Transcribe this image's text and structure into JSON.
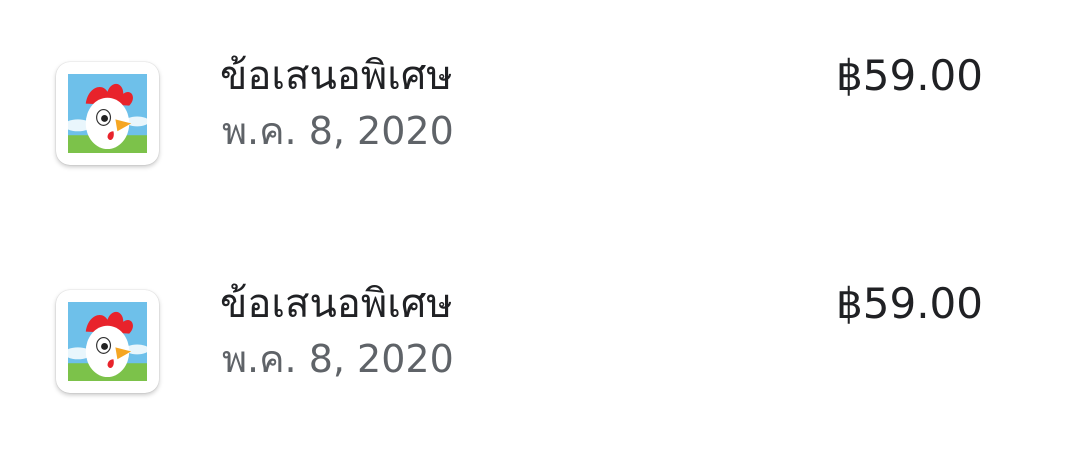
{
  "purchases": [
    {
      "icon": "hay-day-pop-rooster-icon",
      "title": "ข้อเสนอพิเศษ",
      "date": "พ.ค. 8, 2020",
      "price": "฿59.00"
    },
    {
      "icon": "hay-day-pop-rooster-icon",
      "title": "ข้อเสนอพิเศษ",
      "date": "พ.ค. 8, 2020",
      "price": "฿59.00"
    }
  ],
  "colors": {
    "background": "#ffffff",
    "primary_text": "#202124",
    "secondary_text": "#5f6368",
    "icon_sky": "#6ec0ea",
    "icon_grass": "#7cc24a",
    "icon_comb": "#e8232b",
    "icon_beak": "#f5a623"
  }
}
